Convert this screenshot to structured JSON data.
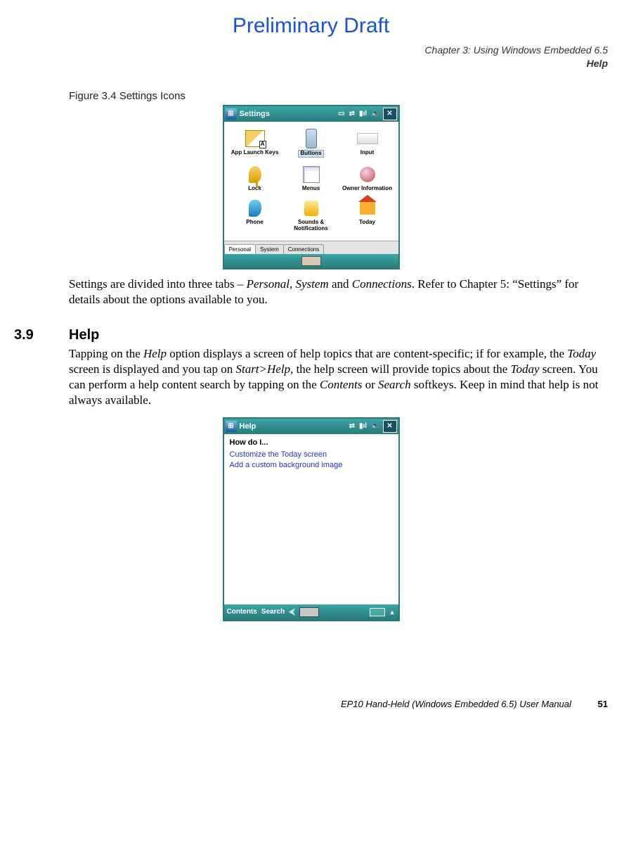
{
  "draft_header": "Preliminary Draft",
  "chapter_header_line1": "Chapter 3:  Using Windows Embedded 6.5",
  "chapter_header_line2": "Help",
  "figure_caption": "Figure 3.4  Settings Icons",
  "settings_screenshot": {
    "titlebar": "Settings",
    "status": "📶",
    "items": [
      {
        "label": "App Launch Keys"
      },
      {
        "label": "Buttons",
        "selected": true
      },
      {
        "label": "Input"
      },
      {
        "label": "Lock"
      },
      {
        "label": "Menus"
      },
      {
        "label": "Owner Information"
      },
      {
        "label": "Phone"
      },
      {
        "label": "Sounds & Notifications"
      },
      {
        "label": "Today"
      }
    ],
    "tabs": [
      "Personal",
      "System",
      "Connections"
    ]
  },
  "para_settings_1": "Settings are divided into three tabs – ",
  "para_settings_em1": "Personal, System",
  "para_settings_2": " and ",
  "para_settings_em2": "Connections",
  "para_settings_3": ". Refer to Chapter 5: “Settings” for details about the options available to you.",
  "section_number": "3.9",
  "section_title": "Help",
  "help_para_1": "Tapping on the ",
  "help_para_em1": "Help",
  "help_para_2": " option displays a screen of help topics that are content-specific; if for example, the ",
  "help_para_em2": "Today",
  "help_para_3": " screen is displayed and you tap on ",
  "help_para_em3": "Start>Help",
  "help_para_4": ", the help screen will provide topics about the ",
  "help_para_em4": "Today",
  "help_para_5": " screen. You can perform a help content search by tapping on the ",
  "help_para_em5": "Contents",
  "help_para_6": " or ",
  "help_para_em6": "Search",
  "help_para_7": " softkeys. Keep in mind that help is not always available.",
  "help_screenshot": {
    "titlebar": "Help",
    "heading": "How do I...",
    "links": [
      "Customize the Today screen",
      "Add a custom background image"
    ],
    "softkeys": [
      "Contents",
      "Search"
    ]
  },
  "footer_text": "EP10 Hand-Held (Windows Embedded 6.5) User Manual",
  "footer_page": "51"
}
